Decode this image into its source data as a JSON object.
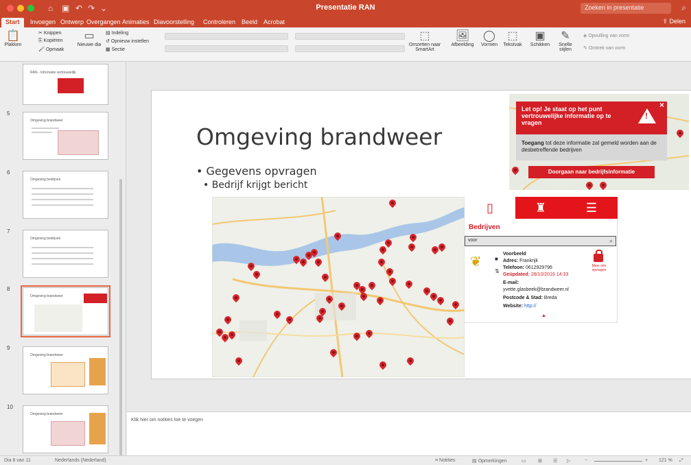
{
  "window": {
    "title": "Presentatie RAN",
    "search_placeholder": "Zoeken in presentatie",
    "share_label": "Delen"
  },
  "tabs": [
    "Start",
    "Invoegen",
    "Ontwerp",
    "Overgangen",
    "Animaties",
    "Diavoorstelling",
    "Controleren",
    "Beeld",
    "Acrobat"
  ],
  "ribbon": {
    "paste": "Plakken",
    "cut": "Knippen",
    "copy": "Kopiëren",
    "format": "Opmaak",
    "new_slide": "Nieuwe dia",
    "layout": "Indeling",
    "reset": "Opnieuw instellen",
    "section": "Sectie",
    "convert_smartart": "Omzetten naar SmartArt",
    "picture": "Afbeelding",
    "shapes": "Vormen",
    "textbox": "Tekstvak",
    "arrange": "Schikken",
    "quick_styles": "Snelle stijlen",
    "shape_fill": "Opvulling van vorm",
    "shape_outline": "Omtrek van vorm"
  },
  "thumbnails": [
    {
      "number": "",
      "title": "RAN - Informatie vertrouwelijk"
    },
    {
      "number": "5",
      "title": "Omgeving brandweer"
    },
    {
      "number": "6",
      "title": "Omgeving bedrijven"
    },
    {
      "number": "7",
      "title": "Omgeving bedrijven"
    },
    {
      "number": "8",
      "title": "Omgeving brandweer"
    },
    {
      "number": "9",
      "title": "Omgeving brandweer"
    },
    {
      "number": "10",
      "title": "Omgeving brandweer"
    }
  ],
  "slide": {
    "title": "Omgeving brandweer",
    "bullet1": "Gegevens opvragen",
    "bullet2": "Bedrijf krijgt bericht"
  },
  "alert": {
    "message": "Let op! Je staat op het punt vertrouwelijke informatie op te vragen",
    "body_bold": "Toegang",
    "body_rest": "tot deze informatie zal gemeld worden aan de desbetreffende bedrijven",
    "button": "Doorgaan naar bedrijfsinformatie",
    "close": "×"
  },
  "panel": {
    "heading": "Bedrijven",
    "search_value": "voor",
    "company": "Voorbeeld",
    "address_label": "Adres:",
    "address": "Frankrijk",
    "phone_label": "Telefoon:",
    "phone": "0612929796",
    "updated_label": "Geüpdated:",
    "updated": "28/10/2016 14:33",
    "email_label": "E-mail:",
    "email": "yvette.glasbeek@brandweer.nl",
    "postcode_label": "Postcode & Stad:",
    "postcode": "Breda",
    "website_label": "Website:",
    "website": "http://",
    "lock_label": "Meer info opvragen"
  },
  "notes": {
    "placeholder": "Klik hier om notities toe te voegen"
  },
  "status": {
    "slide_info": "Dia 8 van 11",
    "language": "Nederlands (Nederland)",
    "notes_btn": "Notities",
    "comments_btn": "Opmerkingen",
    "zoom": "121 %"
  },
  "colors": {
    "accent": "#c9462c",
    "alert_red": "#d31f26",
    "pin_red": "#d6262c"
  }
}
